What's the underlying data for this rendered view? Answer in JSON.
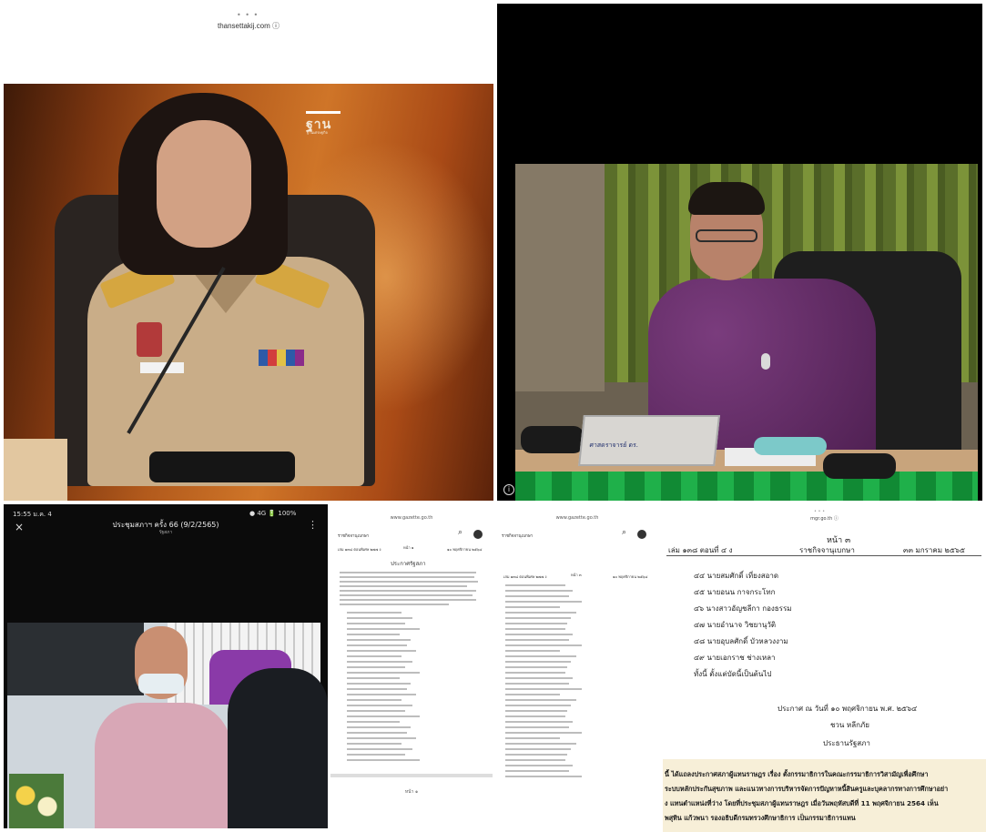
{
  "panel_a": {
    "dots": "• • •",
    "url": "thansettakij.com ⓘ",
    "logo": "ฐาน",
    "logo_sub": "ฐานเศรษฐกิจ"
  },
  "panel_b": {
    "nameplate": "ศาสตราจารย์ ดร.",
    "info_icon": "i"
  },
  "panel_c": {
    "time": "15:55 ม.ค. 4",
    "status": "● 4G 🔋 100%",
    "close_icon": "×",
    "title": "ประชุมสภาฯ ครั้ง 66 (9/2/2565)",
    "subtitle": "รัฐสภา",
    "more_icon": "⋮"
  },
  "panel_d": {
    "dots": "• • •",
    "bar": "www.gazette.go.th",
    "left_label": "ราชกิจจานุเบกษา",
    "search_icon": "⌕",
    "header_left": "เล่ม ๑๓๘ ตอนพิเศษ ๒๗๗ ง",
    "header_mid": "หน้า ๑",
    "header_right": "๑๐ พฤศจิกายน ๒๕๖๔",
    "doc_title": "ประกาศรัฐสภา",
    "page_num": "หน้า ๑"
  },
  "panel_e": {
    "dots": "• • •",
    "bar": "www.gazette.go.th",
    "left_label": "ราชกิจจานุเบกษา",
    "search_icon": "⌕",
    "header_left": "เล่ม ๑๓๘ ตอนพิเศษ ๒๗๗ ง",
    "header_mid": "หน้า ๓",
    "header_right": "๑๐ พฤศจิกายน ๒๕๖๔"
  },
  "panel_f": {
    "dots": "• • •",
    "url": "mgr.go.th ⓘ",
    "page": "หน้า ๓",
    "header_left": "เล่ม ๑๓๘  ตอนที่  ๔  ง",
    "header_mid": "ราชกิจจานุเบกษา",
    "header_right": "๓๓  มกราคม  ๒๕๖๕",
    "names": [
      "๔๔  นายสมศักดิ์  เที่ยงสอาด",
      "๔๕  นายอนน  กาจกระโทก",
      "๔๖  นางสาวอัญชลีกา  กองธรรม",
      "๔๗  นายอำนาจ  วิชยานุวัติ",
      "๔๘  นายอุบลศักดิ์  บัวหลวงงาม",
      "๔๙  นายเอกราช  ช่างเหลา"
    ],
    "closing": "ทั้งนี้ ตั้งแต่บัดนี้เป็นต้นไป",
    "date_line": "ประกาศ ณ วันที่ ๑๐ พฤศจิกายน พ.ศ. ๒๕๖๔",
    "signer": "ชวน หลีกภัย",
    "position": "ประธานรัฐสภา",
    "highlight": [
      "นี้ ได้แถลงประกาศสภาผู้แทนราษฎร เรื่อง ตั้งกรรมาธิการในคณะกรรมาธิการวิสามัญเพื่อศึกษา",
      "ระบบหลักประกันสุขภาพ และแนวทางการบริหารจัดการปัญหาหนี้สินครูและบุคลากรทางการศึกษาอย่า",
      "ง แทนตำแหน่งที่ว่าง โดยที่ประชุมสภาผู้แทนราษฎร เมื่อวันพฤหัสบดีที่ 11 พฤศจิกายน 2564 เห็น",
      "พสุทิน แก้วพนา รองอธิบดีกรมทรวงศึกษาธิการ เป็นกรรมาธิการแทน"
    ]
  }
}
